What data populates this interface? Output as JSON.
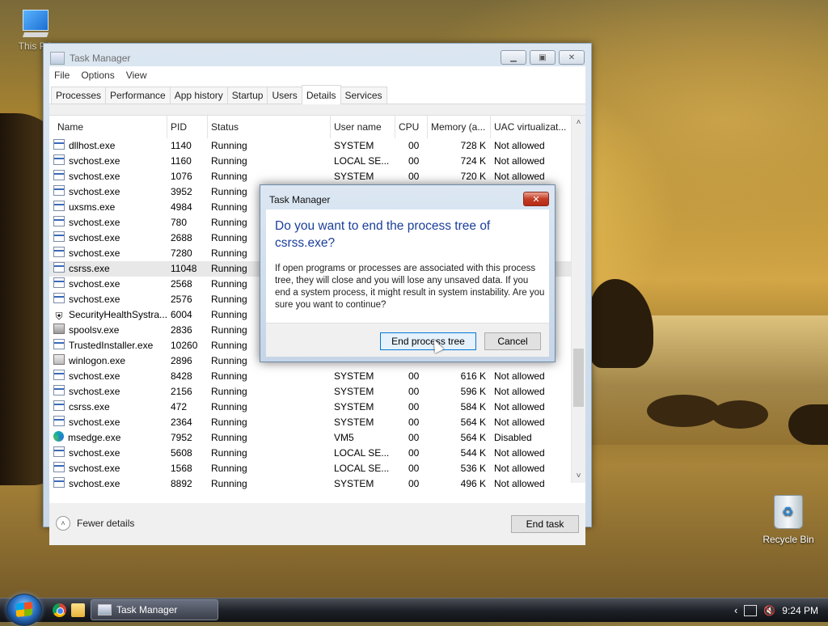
{
  "desktop": {
    "icons": [
      {
        "label": "This PC"
      },
      {
        "label": "Recycle Bin"
      }
    ]
  },
  "window": {
    "title": "Task Manager",
    "menu": [
      "File",
      "Options",
      "View"
    ],
    "tabs": [
      "Processes",
      "Performance",
      "App history",
      "Startup",
      "Users",
      "Details",
      "Services"
    ],
    "active_tab": "Details",
    "columns": [
      "Name",
      "PID",
      "Status",
      "User name",
      "CPU",
      "Memory (a...",
      "UAC virtualizat..."
    ],
    "rows": [
      {
        "icon": "process-icon",
        "name": "dllhost.exe",
        "pid": "1140",
        "status": "Running",
        "user": "SYSTEM",
        "cpu": "00",
        "mem": "728 K",
        "uac": "Not allowed"
      },
      {
        "icon": "process-icon",
        "name": "svchost.exe",
        "pid": "1160",
        "status": "Running",
        "user": "LOCAL SE...",
        "cpu": "00",
        "mem": "724 K",
        "uac": "Not allowed"
      },
      {
        "icon": "process-icon",
        "name": "svchost.exe",
        "pid": "1076",
        "status": "Running",
        "user": "SYSTEM",
        "cpu": "00",
        "mem": "720 K",
        "uac": "Not allowed"
      },
      {
        "icon": "process-icon",
        "name": "svchost.exe",
        "pid": "3952",
        "status": "Running",
        "user": "",
        "cpu": "",
        "mem": "",
        "uac": ""
      },
      {
        "icon": "process-icon",
        "name": "uxsms.exe",
        "pid": "4984",
        "status": "Running",
        "user": "",
        "cpu": "",
        "mem": "",
        "uac": ""
      },
      {
        "icon": "process-icon",
        "name": "svchost.exe",
        "pid": "780",
        "status": "Running",
        "user": "",
        "cpu": "",
        "mem": "",
        "uac": ""
      },
      {
        "icon": "process-icon",
        "name": "svchost.exe",
        "pid": "2688",
        "status": "Running",
        "user": "",
        "cpu": "",
        "mem": "",
        "uac": ""
      },
      {
        "icon": "process-icon",
        "name": "svchost.exe",
        "pid": "7280",
        "status": "Running",
        "user": "",
        "cpu": "",
        "mem": "",
        "uac": ""
      },
      {
        "icon": "process-icon",
        "name": "csrss.exe",
        "pid": "11048",
        "status": "Running",
        "user": "",
        "cpu": "",
        "mem": "",
        "uac": "",
        "selected": true
      },
      {
        "icon": "process-icon",
        "name": "svchost.exe",
        "pid": "2568",
        "status": "Running",
        "user": "",
        "cpu": "",
        "mem": "",
        "uac": ""
      },
      {
        "icon": "process-icon",
        "name": "svchost.exe",
        "pid": "2576",
        "status": "Running",
        "user": "",
        "cpu": "",
        "mem": "",
        "uac": ""
      },
      {
        "icon": "shield-icon",
        "name": "SecurityHealthSystra...",
        "pid": "6004",
        "status": "Running",
        "user": "",
        "cpu": "",
        "mem": "",
        "uac": ""
      },
      {
        "icon": "printer-icon",
        "name": "spoolsv.exe",
        "pid": "2836",
        "status": "Running",
        "user": "",
        "cpu": "",
        "mem": "",
        "uac": ""
      },
      {
        "icon": "process-icon",
        "name": "TrustedInstaller.exe",
        "pid": "10260",
        "status": "Running",
        "user": "",
        "cpu": "",
        "mem": "",
        "uac": ""
      },
      {
        "icon": "window-icon",
        "name": "winlogon.exe",
        "pid": "2896",
        "status": "Running",
        "user": "",
        "cpu": "",
        "mem": "",
        "uac": ""
      },
      {
        "icon": "process-icon",
        "name": "svchost.exe",
        "pid": "8428",
        "status": "Running",
        "user": "SYSTEM",
        "cpu": "00",
        "mem": "616 K",
        "uac": "Not allowed"
      },
      {
        "icon": "process-icon",
        "name": "svchost.exe",
        "pid": "2156",
        "status": "Running",
        "user": "SYSTEM",
        "cpu": "00",
        "mem": "596 K",
        "uac": "Not allowed"
      },
      {
        "icon": "process-icon",
        "name": "csrss.exe",
        "pid": "472",
        "status": "Running",
        "user": "SYSTEM",
        "cpu": "00",
        "mem": "584 K",
        "uac": "Not allowed"
      },
      {
        "icon": "process-icon",
        "name": "svchost.exe",
        "pid": "2364",
        "status": "Running",
        "user": "SYSTEM",
        "cpu": "00",
        "mem": "564 K",
        "uac": "Not allowed"
      },
      {
        "icon": "edge-icon",
        "name": "msedge.exe",
        "pid": "7952",
        "status": "Running",
        "user": "VM5",
        "cpu": "00",
        "mem": "564 K",
        "uac": "Disabled"
      },
      {
        "icon": "process-icon",
        "name": "svchost.exe",
        "pid": "5608",
        "status": "Running",
        "user": "LOCAL SE...",
        "cpu": "00",
        "mem": "544 K",
        "uac": "Not allowed"
      },
      {
        "icon": "process-icon",
        "name": "svchost.exe",
        "pid": "1568",
        "status": "Running",
        "user": "LOCAL SE...",
        "cpu": "00",
        "mem": "536 K",
        "uac": "Not allowed"
      },
      {
        "icon": "process-icon",
        "name": "svchost.exe",
        "pid": "8892",
        "status": "Running",
        "user": "SYSTEM",
        "cpu": "00",
        "mem": "496 K",
        "uac": "Not allowed"
      }
    ],
    "fewer_details": "Fewer details",
    "end_task": "End task"
  },
  "dialog": {
    "title": "Task Manager",
    "close": "✕",
    "main_line1": "Do you want to end the process tree of",
    "main_line2": "csrss.exe?",
    "body": "If open programs or processes are associated with this process tree, they will close and you will lose any unsaved data. If you end a system process, it might result in system instability. Are you sure you want to continue?",
    "primary_button": "End process tree",
    "cancel_button": "Cancel"
  },
  "taskbar": {
    "task_label": "Task Manager",
    "clock": "9:24 PM"
  }
}
